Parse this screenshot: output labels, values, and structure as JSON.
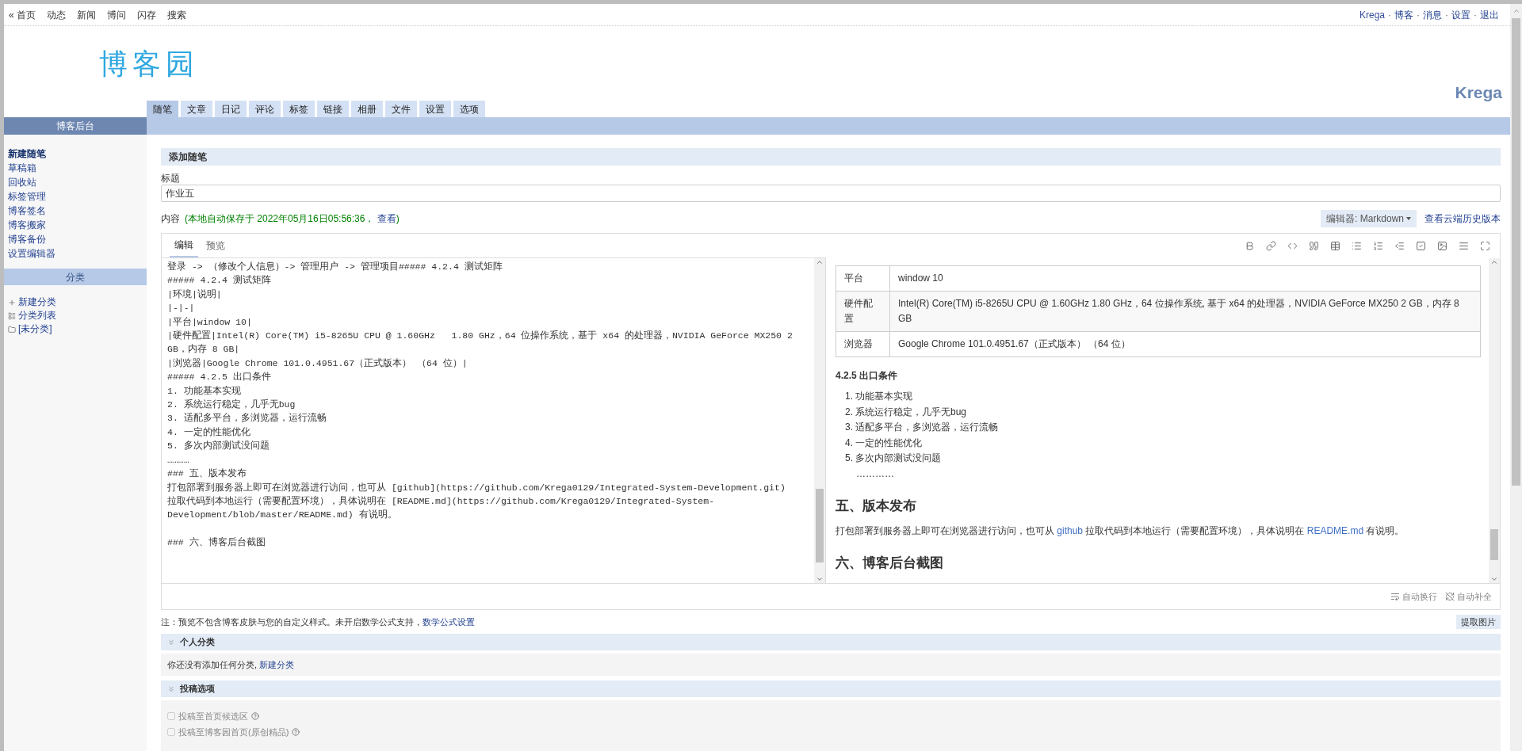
{
  "top_nav": {
    "left": [
      "« 首页",
      "动态",
      "新闻",
      "博问",
      "闪存",
      "搜索"
    ],
    "right": [
      "Krega",
      "博客",
      "消息",
      "设置",
      "退出"
    ],
    "separator": "·"
  },
  "logo": "博客园",
  "blog_name": "Krega",
  "tabs": [
    {
      "label": "随笔",
      "selected": true
    },
    {
      "label": "文章",
      "selected": false
    },
    {
      "label": "日记",
      "selected": false
    },
    {
      "label": "评论",
      "selected": false
    },
    {
      "label": "标签",
      "selected": false
    },
    {
      "label": "链接",
      "selected": false
    },
    {
      "label": "相册",
      "selected": false
    },
    {
      "label": "文件",
      "selected": false
    },
    {
      "label": "设置",
      "selected": false
    },
    {
      "label": "选项",
      "selected": false
    }
  ],
  "sidebar": {
    "title": "博客后台",
    "items": [
      {
        "label": "新建随笔",
        "selected": true
      },
      {
        "label": "草稿箱",
        "selected": false
      },
      {
        "label": "回收站",
        "selected": false
      },
      {
        "label": "标签管理",
        "selected": false
      },
      {
        "label": "博客签名",
        "selected": false
      },
      {
        "label": "博客搬家",
        "selected": false
      },
      {
        "label": "博客备份",
        "selected": false
      },
      {
        "label": "设置编辑器",
        "selected": false
      }
    ],
    "category_title": "分类",
    "category_items": [
      {
        "kind": "add",
        "label": "新建分类"
      },
      {
        "kind": "list",
        "label": "分类列表"
      },
      {
        "kind": "folder",
        "label": "[未分类]"
      }
    ]
  },
  "form": {
    "section_title": "添加随笔",
    "title_label": "标题",
    "title_value": "作业五",
    "content_label": "内容",
    "autosave_text": "(本地自动保存于 2022年05月16日05:56:36，",
    "autosave_link": "查看",
    "autosave_close": ")",
    "editor_select": "编辑器: Markdown",
    "history_link": "查看云端历史版本"
  },
  "editor": {
    "tabs": [
      {
        "label": "编辑",
        "selected": true
      },
      {
        "label": "预览",
        "selected": false
      }
    ],
    "toolbar": [
      {
        "kind": "bold"
      },
      {
        "kind": "link"
      },
      {
        "kind": "code"
      },
      {
        "kind": "quote"
      },
      {
        "kind": "table"
      },
      {
        "kind": "list"
      },
      {
        "kind": "ordered"
      },
      {
        "kind": "outdent"
      },
      {
        "kind": "task"
      },
      {
        "kind": "image"
      },
      {
        "kind": "rule"
      },
      {
        "kind": "fullscreen"
      }
    ],
    "source_lines": [
      "登录 -> （修改个人信息）-> 管理用户 -> 管理项目##### 4.2.4 测试矩阵",
      "##### 4.2.4 测试矩阵",
      "|环境|说明|",
      "|-|-|",
      "|平台|window 10|",
      "|硬件配置|Intel(R) Core(TM) i5-8265U CPU @ 1.60GHz   1.80 GHz，64 位操作系统，基于 x64 的处理器，NVIDIA GeForce MX250 2 GB，内存 8 GB|",
      "|浏览器|Google Chrome 101.0.4951.67（正式版本） （64 位）|",
      "##### 4.2.5 出口条件",
      "1. 功能基本实现",
      "2. 系统运行稳定，几乎无bug",
      "3. 适配多平台，多浏览器，运行流畅",
      "4. 一定的性能优化",
      "5. 多次内部测试没问题",
      "…………",
      "### 五、版本发布",
      "打包部署到服务器上即可在浏览器进行访问，也可从 [github](https://github.com/Krega0129/Integrated-System-Development.git)",
      "拉取代码到本地运行（需要配置环境），具体说明在 [README.md](https://github.com/Krega0129/Integrated-System-Development/blob/master/README.md) 有说明。"
    ],
    "source_tail": "### 六、博客后台截图",
    "preview": {
      "table_rows": [
        [
          "平台",
          "window 10"
        ],
        [
          "硬件配置",
          "Intel(R) Core(TM) i5-8265U CPU @ 1.60GHz 1.80 GHz，64 位操作系统, 基于 x64 的处理器，NVIDIA GeForce MX250 2 GB，内存 8 GB"
        ],
        [
          "浏览器",
          "Google Chrome 101.0.4951.67（正式版本） （64 位）"
        ]
      ],
      "heading": "4.2.5 出口条件",
      "list": [
        {
          "num": "1.",
          "text": "功能基本实现"
        },
        {
          "num": "2.",
          "text": "系统运行稳定，几乎无bug"
        },
        {
          "num": "3.",
          "text": "适配多平台，多浏览器，运行流畅"
        },
        {
          "num": "4.",
          "text": "一定的性能优化"
        },
        {
          "num": "5.",
          "text": "多次内部测试没问题"
        }
      ],
      "dots": "…………",
      "h2_release": "五、版本发布",
      "paragraph": [
        {
          "kind": "text",
          "text": "打包部署到服务器上即可在浏览器进行访问，也可从 "
        },
        {
          "kind": "link",
          "text": "github"
        },
        {
          "kind": "text",
          "text": " 拉取代码到本地运行（需要配置环境），具体说明在 "
        },
        {
          "kind": "link",
          "text": "README.md"
        },
        {
          "kind": "text",
          "text": " 有说明。"
        }
      ],
      "h2_screens": "六、博客后台截图"
    },
    "footer": [
      {
        "kind": "wrap",
        "label": "自动换行"
      },
      {
        "kind": "autocomplete",
        "label": "自动补全"
      }
    ]
  },
  "note": {
    "text": "注：预览不包含博客皮肤与您的自定义样式。未开启数学公式支持，",
    "link": "数学公式设置"
  },
  "extract_button": "提取图片",
  "category_section": {
    "title": "个人分类",
    "text": "你还没有添加任何分类,",
    "link": "新建分类"
  },
  "submit_section": {
    "title": "投稿选项",
    "options": [
      {
        "label": "投稿至首页候选区",
        "checked": false,
        "disabled": true
      },
      {
        "label": "投稿至博客园首页(原创精品)",
        "checked": false,
        "disabled": true
      }
    ]
  }
}
